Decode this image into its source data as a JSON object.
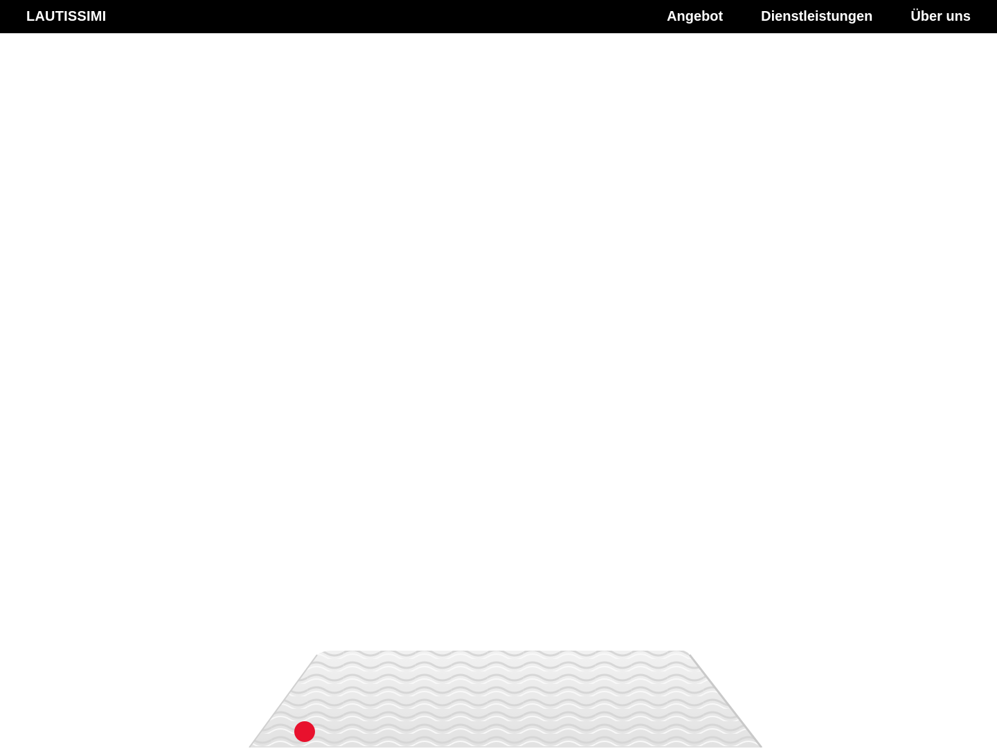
{
  "header": {
    "brand": "LAUTISSIMI",
    "nav": [
      {
        "label": "Angebot"
      },
      {
        "label": "Dienstleistungen"
      },
      {
        "label": "Über uns"
      }
    ]
  },
  "colors": {
    "header_bg": "#000000",
    "header_text": "#ffffff",
    "hotspot": "#e8112d"
  },
  "hero": {
    "product_image": "mattress-topper-image",
    "hotspot_icon": "hotspot-dot-icon"
  }
}
